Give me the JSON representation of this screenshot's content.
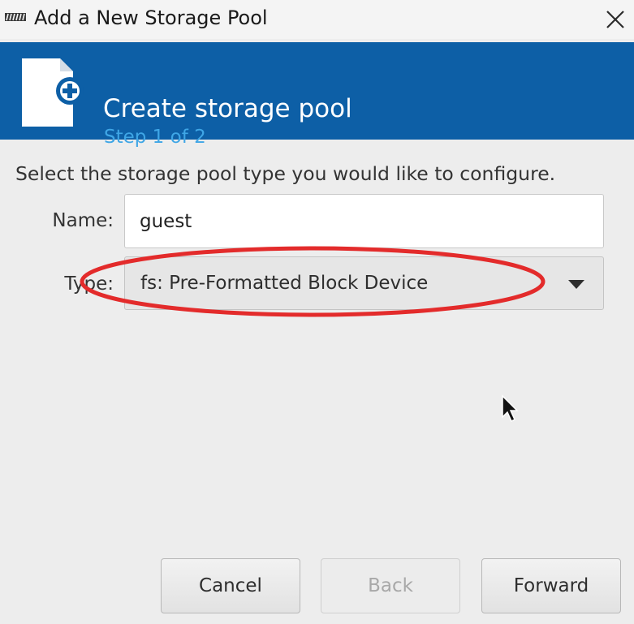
{
  "window": {
    "title": "Add a New Storage Pool",
    "app_icon": "storage-app-icon",
    "close_icon": "close-icon"
  },
  "banner": {
    "heading": "Create storage pool",
    "step": "Step 1 of 2",
    "icon": "new-document-icon",
    "background_color": "#0d5fa6",
    "step_color": "#3fa6e6"
  },
  "form": {
    "instruction": "Select the storage pool type you would like to configure.",
    "name_label": "Name:",
    "name_value": "guest",
    "type_label": "Type:",
    "type_value": "fs: Pre-Formatted Block Device"
  },
  "annotation": {
    "shape": "ellipse",
    "color": "#e32b2b"
  },
  "buttons": {
    "cancel": "Cancel",
    "back": "Back",
    "forward": "Forward"
  }
}
